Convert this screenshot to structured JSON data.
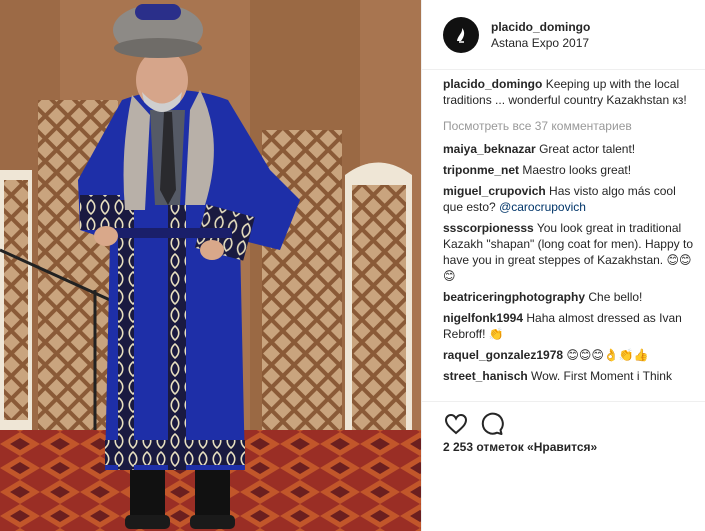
{
  "post": {
    "username": "placido_domingo",
    "location": "Astana Expo 2017",
    "likes_text": "2 253 отметок «Нравится»"
  },
  "caption": {
    "user": "placido_domingo",
    "text": "Keeping up with the local traditions ... wonderful country Kazakhstan кз!"
  },
  "view_all_comments": "Посмотреть все 37 комментариев",
  "comments": [
    {
      "user": "maiya_beknazar",
      "text": "Great actor talent!"
    },
    {
      "user": "triponme_net",
      "text": "Maestro looks great!"
    },
    {
      "user": "miguel_crupovich",
      "text": "Has visto algo más cool que esto?",
      "mention": "@carocrupovich"
    },
    {
      "user": "ssscorpionesss",
      "text": "You look great in traditional Kazakh \"shapan\" (long coat for men). Happy to have you in great steppes of Kazakhstan.",
      "emoji": "😊😊😊"
    },
    {
      "user": "beatriceringphotography",
      "text": "Che bello!"
    },
    {
      "user": "nigelfonk1994",
      "text": "Haha almost dressed as Ivan Rebroff!",
      "emoji": "👏"
    },
    {
      "user": "raquel_gonzalez1978",
      "text": "",
      "emoji": "😊😊😊👌👏👍"
    },
    {
      "user": "street_hanisch",
      "text": "Wow. First Moment i Think"
    }
  ],
  "icons": {
    "avatar": "avatar-icon",
    "like": "heart-icon",
    "comment": "speech-bubble-icon"
  },
  "colors": {
    "link": "#003569",
    "muted": "#999999",
    "coat": "#1e2fa8",
    "background": "#b07a52"
  }
}
